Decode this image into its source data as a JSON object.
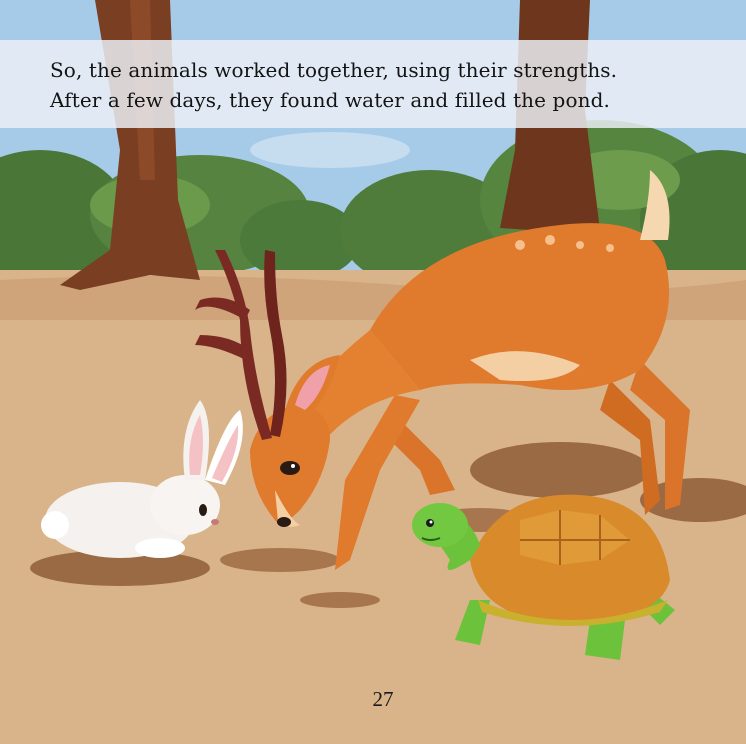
{
  "story": {
    "lines": [
      "So, the animals worked together, using their strengths.",
      "After a few days, they found water and filled the pond."
    ],
    "page_number": "27"
  },
  "illustration": {
    "characters": [
      "deer",
      "rabbit",
      "tortoise"
    ],
    "colors": {
      "sky": "#9ec6e6",
      "ground": "#d9b48a",
      "deer": "#e07a2c",
      "antler": "#7a2a22",
      "rabbit": "#f4f1ee",
      "tortoise_shell": "#d98a2a",
      "tortoise_skin": "#6cc23a",
      "tree_trunk": "#7a3e22",
      "bushes": "#4f7a3a"
    }
  }
}
